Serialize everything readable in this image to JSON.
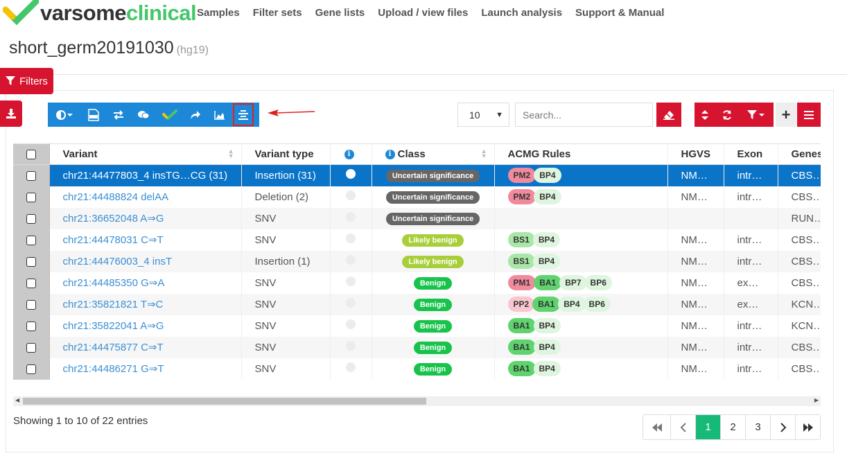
{
  "brand": {
    "logo_text_1": "varsome",
    "logo_text_2": "clinical"
  },
  "nav": [
    "Samples",
    "Filter sets",
    "Gene lists",
    "Upload / view files",
    "Launch analysis",
    "Support & Manual"
  ],
  "page": {
    "title": "short_germ20191030",
    "assembly": "(hg19)"
  },
  "filters_label": "Filters",
  "controls": {
    "page_length": "10",
    "search_placeholder": "Search..."
  },
  "table": {
    "headers": [
      "Variant",
      "Variant type",
      "",
      "Class",
      "ACMG Rules",
      "HGVS",
      "Exon",
      "Genes"
    ],
    "rows": [
      {
        "variant": "chr21:44477803_4 insTG…CG (31)",
        "type": "Insertion (31)",
        "class": "Uncertain significance",
        "class_kind": "unc",
        "rules": [
          "PM2",
          "BP4"
        ],
        "hgvs": "NM…",
        "exon": "intr…",
        "genes": "CBS…",
        "selected": true
      },
      {
        "variant": "chr21:44488824 delAA",
        "type": "Deletion (2)",
        "class": "Uncertain significance",
        "class_kind": "unc",
        "rules": [
          "PM2",
          "BP4"
        ],
        "hgvs": "NM…",
        "exon": "intr…",
        "genes": "CBS…"
      },
      {
        "variant": "chr21:36652048 A⇒G",
        "type": "SNV",
        "class": "Uncertain significance",
        "class_kind": "unc",
        "rules": [],
        "hgvs": "",
        "exon": "",
        "genes": "RUN…"
      },
      {
        "variant": "chr21:44478031 C⇒T",
        "type": "SNV",
        "class": "Likely benign",
        "class_kind": "lb",
        "rules": [
          "BS1",
          "BP4"
        ],
        "hgvs": "NM…",
        "exon": "intr…",
        "genes": "CBS…"
      },
      {
        "variant": "chr21:44476003_4 insT",
        "type": "Insertion (1)",
        "class": "Likely benign",
        "class_kind": "lb",
        "rules": [
          "BS1",
          "BP4"
        ],
        "hgvs": "NM…",
        "exon": "intr…",
        "genes": "CBS…"
      },
      {
        "variant": "chr21:44485350 G⇒A",
        "type": "SNV",
        "class": "Benign",
        "class_kind": "ben",
        "rules": [
          "PM1",
          "BA1",
          "BP7",
          "BP6"
        ],
        "hgvs": "NM…",
        "exon": "ex…",
        "genes": "CBS…"
      },
      {
        "variant": "chr21:35821821 T⇒C",
        "type": "SNV",
        "class": "Benign",
        "class_kind": "ben",
        "rules": [
          "PP2",
          "BA1",
          "BP4",
          "BP6"
        ],
        "hgvs": "NM…",
        "exon": "ex…",
        "genes": "KCN…"
      },
      {
        "variant": "chr21:35822041 A⇒G",
        "type": "SNV",
        "class": "Benign",
        "class_kind": "ben",
        "rules": [
          "BA1",
          "BP4"
        ],
        "hgvs": "NM…",
        "exon": "intr…",
        "genes": "KCN…"
      },
      {
        "variant": "chr21:44475877 C⇒T",
        "type": "SNV",
        "class": "Benign",
        "class_kind": "ben",
        "rules": [
          "BA1",
          "BP4"
        ],
        "hgvs": "NM…",
        "exon": "intr…",
        "genes": "CBS…"
      },
      {
        "variant": "chr21:44486271 G⇒T",
        "type": "SNV",
        "class": "Benign",
        "class_kind": "ben",
        "rules": [
          "BA1",
          "BP4"
        ],
        "hgvs": "NM…",
        "exon": "intr…",
        "genes": "CBS…"
      }
    ]
  },
  "footer": {
    "info": "Showing 1 to 10 of 22 entries",
    "pages": [
      "1",
      "2",
      "3"
    ]
  },
  "colors": {
    "accent_red": "#d7142f",
    "toolbar_blue": "#1e88d8",
    "selected_row": "#0a74c9",
    "active_page": "#17b978"
  },
  "icons": [
    "filter-icon",
    "download-icon",
    "contrast-icon",
    "vcf-file-icon",
    "swap-icon",
    "comments-icon",
    "varsome-check-icon",
    "share-icon",
    "chart-icon",
    "align-center-icon",
    "eraser-icon",
    "sort-icon",
    "refresh-icon",
    "filter-dropdown-icon",
    "plus-icon",
    "menu-icon"
  ]
}
